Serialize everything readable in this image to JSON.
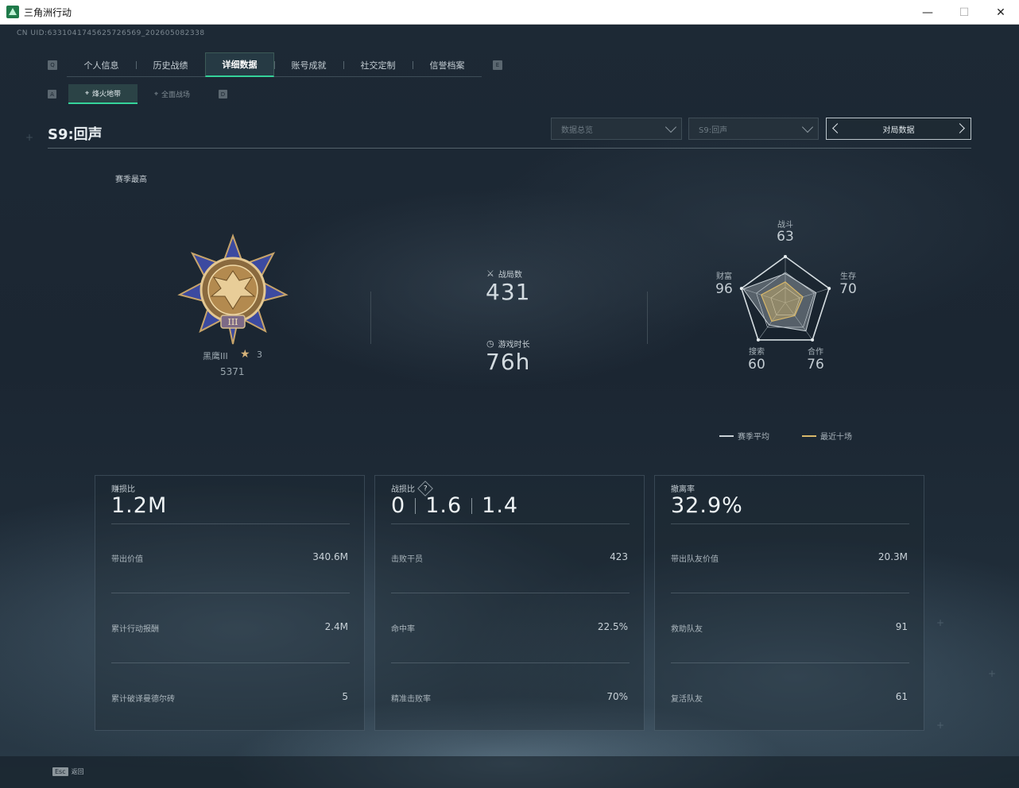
{
  "window": {
    "title": "三角洲行动",
    "min": "—",
    "max": "☐",
    "close": "✕"
  },
  "uid": "CN UID:63310417456257265​69_202605082338",
  "nav": {
    "left_key": "Q",
    "right_key": "E",
    "tabs": [
      {
        "label": "个人信息",
        "active": false
      },
      {
        "label": "历史战绩",
        "active": false
      },
      {
        "label": "详细数据",
        "active": true
      },
      {
        "label": "账号成就",
        "active": false
      },
      {
        "label": "社交定制",
        "active": false
      },
      {
        "label": "信誉档案",
        "active": false
      }
    ]
  },
  "subnav": {
    "left_key": "A",
    "right_key": "D",
    "tabs": [
      {
        "label": "烽火地带",
        "icon": "crosshair-icon",
        "active": true
      },
      {
        "label": "全面战场",
        "icon": "target-icon",
        "active": false
      }
    ]
  },
  "season": {
    "title": "S9:回声",
    "filter1": "数据总览",
    "filter2": "S9:回声",
    "match_nav": "对局数据"
  },
  "rank": {
    "season_best": "赛季最高",
    "name": "黑鹰III",
    "stars": "3",
    "score": "5371"
  },
  "summary": {
    "matches_label": "战局数",
    "matches": "431",
    "playtime_label": "游戏时长",
    "playtime": "76h"
  },
  "radar": {
    "axes": [
      {
        "label": "战斗",
        "value": "63"
      },
      {
        "label": "生存",
        "value": "70"
      },
      {
        "label": "合作",
        "value": "76"
      },
      {
        "label": "搜索",
        "value": "60"
      },
      {
        "label": "财富",
        "value": "96"
      }
    ],
    "season_avg": [
      63,
      70,
      76,
      60,
      96
    ],
    "recent_ten": [
      45,
      40,
      35,
      50,
      55
    ],
    "legend_avg": "赛季平均",
    "legend_recent": "最近十场",
    "colors": {
      "avg": "#c9d1d6",
      "recent": "#d8b86a"
    }
  },
  "cards": [
    {
      "label": "赚损比",
      "big": [
        "1.2M"
      ],
      "help": false,
      "rows": [
        {
          "k": "带出价值",
          "v": "340.6M"
        },
        {
          "k": "累计行动报酬",
          "v": "2.4M"
        },
        {
          "k": "累计破译曼德尔砖",
          "v": "5"
        }
      ]
    },
    {
      "label": "战损比",
      "big": [
        "0",
        "1.6",
        "1.4"
      ],
      "help": true,
      "help_text": "?",
      "rows": [
        {
          "k": "击败干员",
          "v": "423"
        },
        {
          "k": "命中率",
          "v": "22.5%"
        },
        {
          "k": "精准击败率",
          "v": "70%"
        }
      ]
    },
    {
      "label": "撤离率",
      "big": [
        "32.9%"
      ],
      "help": false,
      "rows": [
        {
          "k": "带出队友价值",
          "v": "20.3M"
        },
        {
          "k": "救助队友",
          "v": "91"
        },
        {
          "k": "复活队友",
          "v": "61"
        }
      ]
    }
  ],
  "bottom": {
    "esc_key": "Esc",
    "esc_label": "返回"
  }
}
